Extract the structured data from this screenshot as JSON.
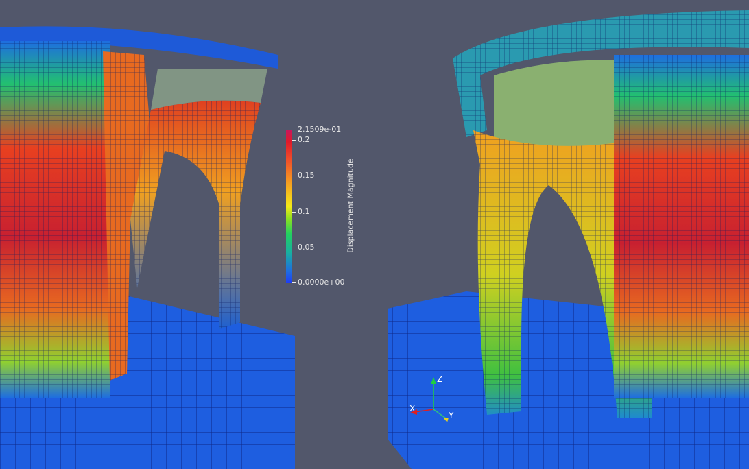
{
  "color_legend": {
    "title": "Displacement Magnitude",
    "max_label": "2.1509e-01",
    "min_label": "0.0000e+00",
    "ticks": [
      "0.2",
      "0.15",
      "0.1",
      "0.05"
    ],
    "range": [
      0,
      0.21509
    ],
    "tick_values": [
      0.2,
      0.15,
      0.1,
      0.05
    ]
  },
  "orientation_axes": {
    "x": "X",
    "y": "Y",
    "z": "Z",
    "colors": {
      "x": "#e02020",
      "y": "#e8d020",
      "z": "#20d040"
    }
  },
  "colors": {
    "background": "#52576b",
    "low": "#1e3cf5",
    "high": "#c8165e"
  }
}
